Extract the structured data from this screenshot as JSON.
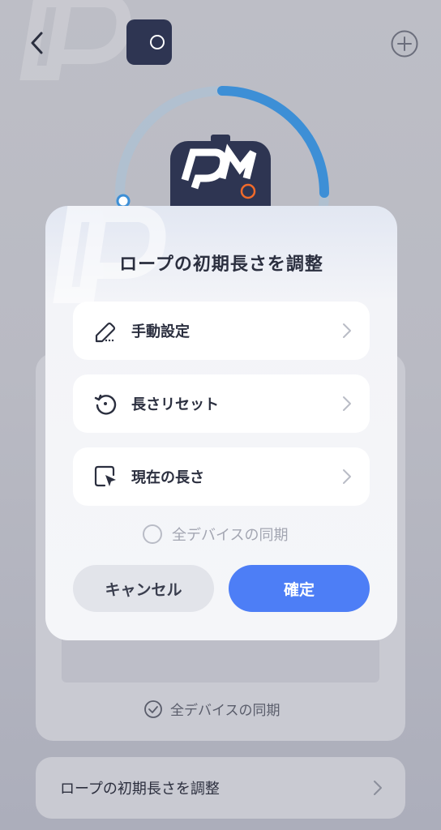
{
  "modal": {
    "title": "ロープの初期長さを調整",
    "options": [
      {
        "label": "手動設定",
        "icon": "edit-icon"
      },
      {
        "label": "長さリセット",
        "icon": "reset-icon"
      },
      {
        "label": "現在の長さ",
        "icon": "pointer-icon"
      }
    ],
    "sync_label": "全デバイスの同期",
    "cancel_label": "キャンセル",
    "confirm_label": "確定"
  },
  "background": {
    "sync_label": "全デバイスの同期",
    "bottom_row_label": "ロープの初期長さを調整"
  },
  "colors": {
    "accent": "#4d7ef6",
    "ring": "#3d8fd6",
    "device_body": "#2e3552"
  }
}
